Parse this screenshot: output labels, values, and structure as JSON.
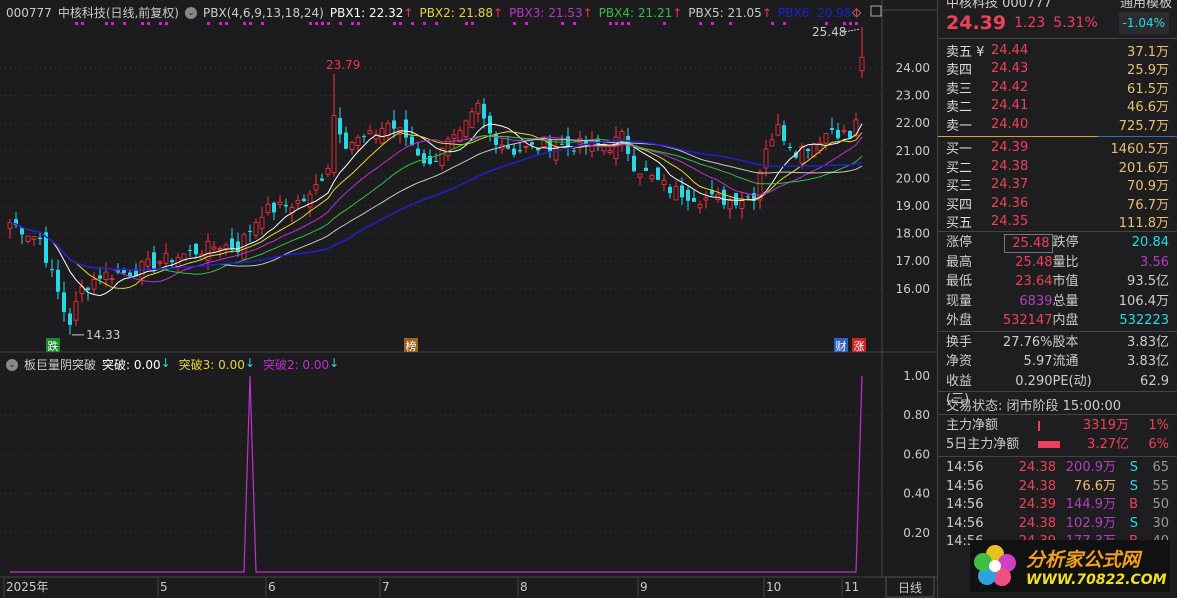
{
  "header": {
    "code": "000777",
    "name": "中核科技(日线,前复权)",
    "formula": "PBX(4,6,9,13,18,24)",
    "pbx": [
      {
        "label": "PBX1: 22.32",
        "color": "#ffffff"
      },
      {
        "label": "PBX2: 21.88",
        "color": "#e6d43a"
      },
      {
        "label": "PBX3: 21.53",
        "color": "#c030d0"
      },
      {
        "label": "PBX4: 21.21",
        "color": "#30c040"
      },
      {
        "label": "PBX5: 21.05",
        "color": "#c8c8c8"
      },
      {
        "label": "PBX6: 20.98",
        "color": "#2020d0"
      }
    ],
    "arrow": "↑"
  },
  "annotations": {
    "high_label": "23.79",
    "low_label": "14.33",
    "limit_label": "25.48",
    "markers": [
      {
        "text": "跌",
        "color": "#1a8a2a"
      },
      {
        "text": "榜",
        "color": "#a06020"
      },
      {
        "text": "财",
        "color": "#3060c0"
      },
      {
        "text": "涨",
        "color": "#d02020"
      }
    ]
  },
  "indicator": {
    "name": "板巨量阴突破",
    "items": [
      {
        "label": "突破: 0.00",
        "color": "#ffffff"
      },
      {
        "label": "突破3: 0.00",
        "color": "#e6d43a"
      },
      {
        "label": "突破2: 0.00",
        "color": "#c030d0"
      }
    ],
    "arrow": "↓"
  },
  "axis": {
    "price_ticks": [
      "24.00",
      "23.00",
      "22.00",
      "21.00",
      "20.00",
      "19.00",
      "18.00",
      "17.00",
      "16.00"
    ],
    "ind_ticks": [
      "1.00",
      "0.80",
      "0.60",
      "0.40",
      "0.20"
    ],
    "months": [
      {
        "label": "2025年",
        "idx": 0
      },
      {
        "label": "5",
        "idx": 25
      },
      {
        "label": "6",
        "idx": 43
      },
      {
        "label": "7",
        "idx": 62
      },
      {
        "label": "8",
        "idx": 85
      },
      {
        "label": "9",
        "idx": 105
      },
      {
        "label": "10",
        "idx": 126
      },
      {
        "label": "11",
        "idx": 139
      }
    ],
    "period": "日线"
  },
  "chart_data": {
    "type": "candlestick",
    "ma_periods": [
      4,
      6,
      9,
      13,
      18,
      24
    ],
    "close_keypoints": [
      [
        0,
        18.4
      ],
      [
        5,
        17.8
      ],
      [
        9,
        15.2
      ],
      [
        10,
        14.8
      ],
      [
        12,
        16.0
      ],
      [
        15,
        16.5
      ],
      [
        20,
        16.6
      ],
      [
        25,
        17.0
      ],
      [
        30,
        17.3
      ],
      [
        35,
        17.6
      ],
      [
        38,
        17.5
      ],
      [
        42,
        18.8
      ],
      [
        46,
        19.0
      ],
      [
        50,
        19.3
      ],
      [
        53,
        20.5
      ],
      [
        54,
        22.3
      ],
      [
        56,
        21.3
      ],
      [
        60,
        21.5
      ],
      [
        63,
        22.0
      ],
      [
        66,
        21.5
      ],
      [
        70,
        20.4
      ],
      [
        72,
        21.2
      ],
      [
        75,
        21.5
      ],
      [
        78,
        22.6
      ],
      [
        80,
        21.6
      ],
      [
        84,
        21.0
      ],
      [
        90,
        21.2
      ],
      [
        100,
        21.2
      ],
      [
        102,
        21.5
      ],
      [
        104,
        20.5
      ],
      [
        107,
        20.0
      ],
      [
        110,
        19.6
      ],
      [
        115,
        19.3
      ],
      [
        120,
        19.2
      ],
      [
        124,
        19.4
      ],
      [
        126,
        21.2
      ],
      [
        128,
        21.8
      ],
      [
        131,
        21.0
      ],
      [
        134,
        21.3
      ],
      [
        137,
        21.8
      ],
      [
        140,
        21.5
      ],
      [
        141,
        22.0
      ],
      [
        142,
        24.39
      ]
    ],
    "indicator_spikes": [
      40,
      142
    ]
  },
  "side": {
    "title": "中核科技 000777",
    "template": "通用模板",
    "price": "24.39",
    "change": "1.23",
    "pct": "5.31%",
    "index_pct": "-1.04%",
    "asks": [
      [
        "卖五 ¥",
        "24.44",
        "37.1万"
      ],
      [
        "卖四",
        "24.43",
        "25.9万"
      ],
      [
        "卖三",
        "24.42",
        "61.5万"
      ],
      [
        "卖二",
        "24.41",
        "46.6万"
      ],
      [
        "卖一",
        "24.40",
        "725.7万"
      ]
    ],
    "bids": [
      [
        "买一",
        "24.39",
        "1460.5万"
      ],
      [
        "买二",
        "24.38",
        "201.6万"
      ],
      [
        "买三",
        "24.37",
        "70.9万"
      ],
      [
        "买四",
        "24.36",
        "76.7万"
      ],
      [
        "买五",
        "24.35",
        "111.8万"
      ]
    ],
    "stats": [
      [
        "涨停",
        "25.48",
        "跌停",
        "20.84"
      ],
      [
        "最高",
        "25.48",
        "量比",
        "3.56"
      ],
      [
        "最低",
        "23.64",
        "市值",
        "93.5亿"
      ],
      [
        "现量",
        "6839",
        "总量",
        "106.4万"
      ],
      [
        "外盘",
        "532147",
        "内盘",
        "532223"
      ]
    ],
    "stats2": [
      [
        "换手",
        "27.76%",
        "股本",
        "3.83亿"
      ],
      [
        "净资",
        "5.97",
        "流通",
        "3.83亿"
      ],
      [
        "收益(三)",
        "0.290",
        "PE(动)",
        "62.9"
      ]
    ],
    "status": "交易状态: 闭市阶段 15:00:00",
    "flow": [
      [
        "主力净额",
        "3319万",
        "1%"
      ],
      [
        "5日主力净额",
        "3.27亿",
        "6%"
      ]
    ],
    "ticks": [
      [
        "14:56",
        "24.38",
        "200.9万",
        "S",
        "65"
      ],
      [
        "14:56",
        "24.38",
        "76.6万",
        "S",
        "55"
      ],
      [
        "14:56",
        "24.39",
        "144.9万",
        "B",
        "50"
      ],
      [
        "14:56",
        "24.38",
        "102.9万",
        "S",
        "30"
      ],
      [
        "14:56",
        "24.39",
        "177.3万",
        "B",
        "40"
      ]
    ],
    "logo": {
      "name": "分析家公式网",
      "url": "WWW.70822.COM"
    }
  }
}
